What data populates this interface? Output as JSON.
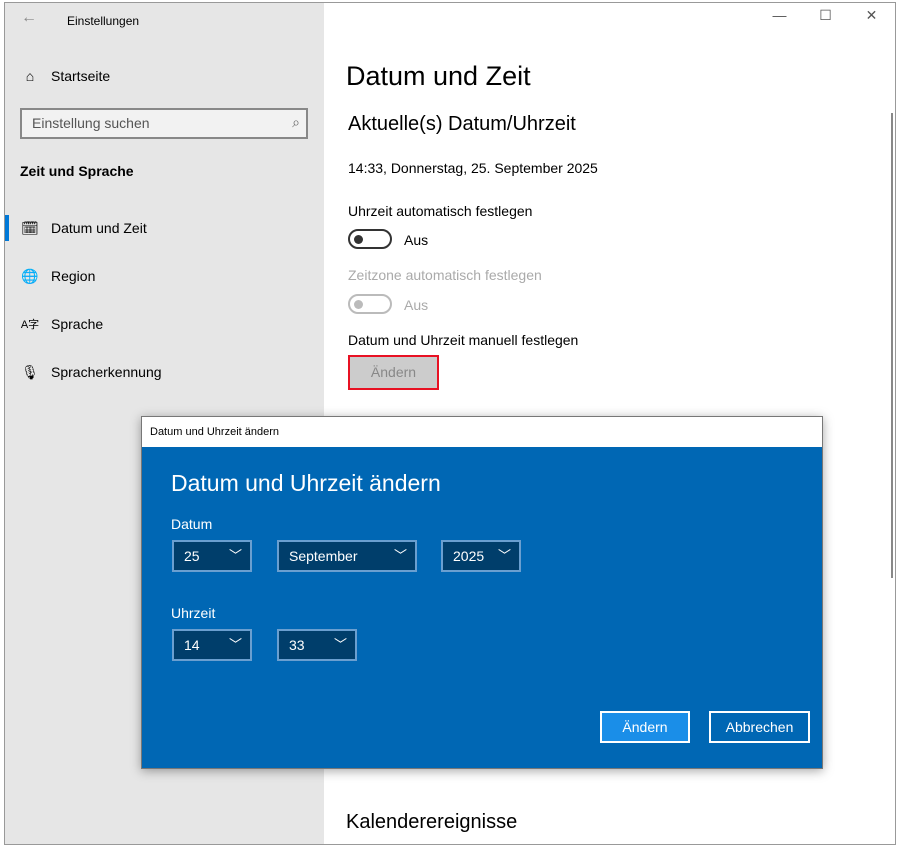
{
  "window": {
    "title": "Einstellungen",
    "minimize": "—",
    "maximize": "☐",
    "close": "✕"
  },
  "sidebar": {
    "home": "Startseite",
    "search_placeholder": "Einstellung suchen",
    "section": "Zeit und Sprache",
    "items": [
      {
        "label": "Datum und Zeit",
        "icon": "🗓"
      },
      {
        "label": "Region",
        "icon": "🌐"
      },
      {
        "label": "Sprache",
        "icon": "A字"
      },
      {
        "label": "Spracherkennung",
        "icon": "🎙"
      }
    ]
  },
  "main": {
    "title": "Datum und Zeit",
    "subtitle": "Aktuelle(s) Datum/Uhrzeit",
    "current": "14:33, Donnerstag, 25. September 2025",
    "auto_time_label": "Uhrzeit automatisch festlegen",
    "auto_time_state": "Aus",
    "auto_zone_label": "Zeitzone automatisch festlegen",
    "auto_zone_state": "Aus",
    "manual_label": "Datum und Uhrzeit manuell festlegen",
    "change_button": "Ändern",
    "calendar_heading": "Kalenderereignisse"
  },
  "dialog": {
    "window_title": "Datum und Uhrzeit ändern",
    "heading": "Datum und Uhrzeit ändern",
    "date_label": "Datum",
    "day": "25",
    "month": "September",
    "year": "2025",
    "time_label": "Uhrzeit",
    "hour": "14",
    "minute": "33",
    "ok": "Ändern",
    "cancel": "Abbrechen"
  }
}
